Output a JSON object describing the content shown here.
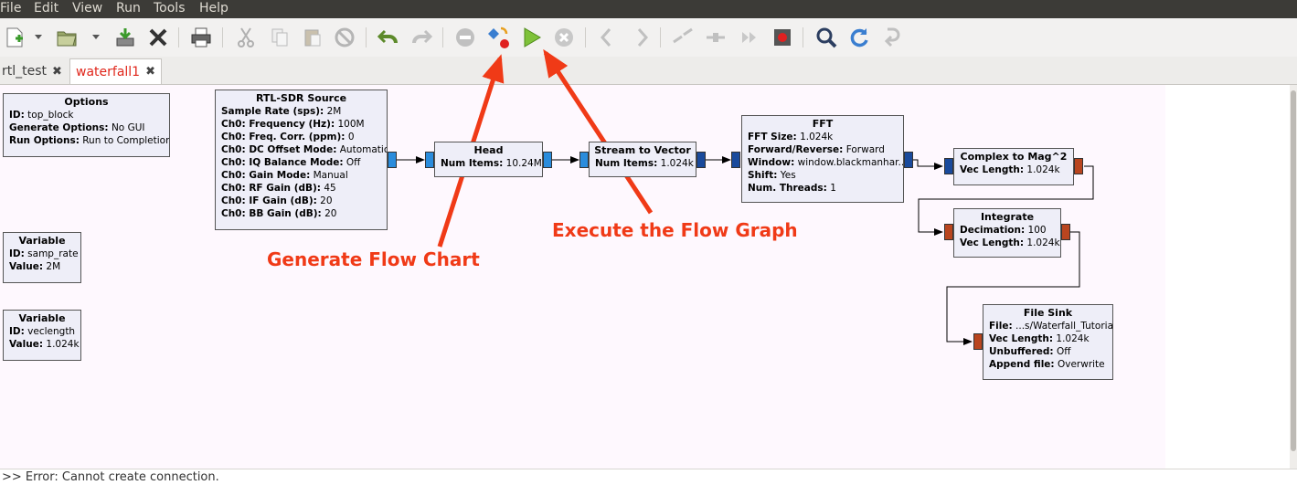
{
  "menu": [
    "File",
    "Edit",
    "View",
    "Run",
    "Tools",
    "Help"
  ],
  "toolbar": {
    "icons": [
      "new-icon",
      "open-icon",
      "save-icon",
      "close-icon",
      "print-icon",
      "cut-icon",
      "copy-icon",
      "paste-icon",
      "delete-icon",
      "undo-icon",
      "redo-icon",
      "disable-icon",
      "generate-icon",
      "execute-icon",
      "kill-icon",
      "rotate-left-icon",
      "rotate-right-icon",
      "disconnect-icon",
      "connect-icon",
      "bypass-icon",
      "stop-icon",
      "find-icon",
      "reload-icon",
      "bypass-arrow-icon"
    ]
  },
  "tabs": [
    {
      "label": "rtl_test",
      "active": false
    },
    {
      "label": "waterfall1",
      "active": true
    }
  ],
  "blocks": {
    "options": {
      "title": "Options",
      "rows": [
        [
          "ID:",
          "top_block"
        ],
        [
          "Generate Options:",
          "No GUI"
        ],
        [
          "Run Options:",
          "Run to Completion"
        ]
      ]
    },
    "var_samp": {
      "title": "Variable",
      "rows": [
        [
          "ID:",
          "samp_rate"
        ],
        [
          "Value:",
          "2M"
        ]
      ]
    },
    "var_vec": {
      "title": "Variable",
      "rows": [
        [
          "ID:",
          "veclength"
        ],
        [
          "Value:",
          "1.024k"
        ]
      ]
    },
    "rtl": {
      "title": "RTL-SDR Source",
      "rows": [
        [
          "Sample Rate (sps):",
          "2M"
        ],
        [
          "Ch0: Frequency (Hz):",
          "100M"
        ],
        [
          "Ch0: Freq. Corr. (ppm):",
          "0"
        ],
        [
          "Ch0: DC Offset Mode:",
          "Automatic"
        ],
        [
          "Ch0: IQ Balance Mode:",
          "Off"
        ],
        [
          "Ch0: Gain Mode:",
          "Manual"
        ],
        [
          "Ch0: RF Gain (dB):",
          "45"
        ],
        [
          "Ch0: IF Gain (dB):",
          "20"
        ],
        [
          "Ch0: BB Gain (dB):",
          "20"
        ]
      ]
    },
    "head": {
      "title": "Head",
      "rows": [
        [
          "Num Items:",
          "10.24M"
        ]
      ]
    },
    "s2v": {
      "title": "Stream to Vector",
      "rows": [
        [
          "Num Items:",
          "1.024k"
        ]
      ]
    },
    "fft": {
      "title": "FFT",
      "rows": [
        [
          "FFT Size:",
          "1.024k"
        ],
        [
          "Forward/Reverse:",
          "Forward"
        ],
        [
          "Window:",
          "window.blackmanhar..."
        ],
        [
          "Shift:",
          "Yes"
        ],
        [
          "Num. Threads:",
          "1"
        ]
      ]
    },
    "c2m": {
      "title": "Complex to Mag^2",
      "rows": [
        [
          "Vec Length:",
          "1.024k"
        ]
      ]
    },
    "integrate": {
      "title": "Integrate",
      "rows": [
        [
          "Decimation:",
          "100"
        ],
        [
          "Vec Length:",
          "1.024k"
        ]
      ]
    },
    "filesink": {
      "title": "File Sink",
      "rows": [
        [
          "File:",
          "...s/Waterfall_Tutorial"
        ],
        [
          "Vec Length:",
          "1.024k"
        ],
        [
          "Unbuffered:",
          "Off"
        ],
        [
          "Append file:",
          "Overwrite"
        ]
      ]
    }
  },
  "annotations": {
    "generate": "Generate Flow Chart",
    "execute": "Execute the Flow Graph",
    "color": "#f03a17"
  },
  "status": ">> Error: Cannot create connection."
}
